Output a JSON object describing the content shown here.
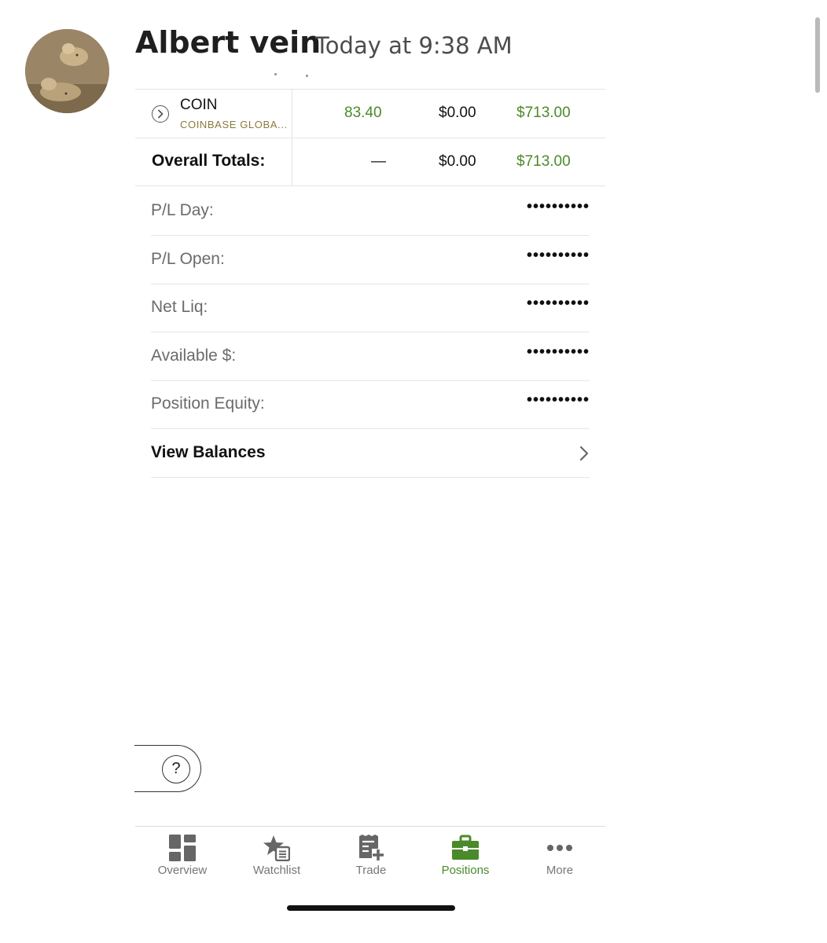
{
  "message": {
    "author": "Albert vein",
    "timestamp": "Today at 9:38 AM"
  },
  "position": {
    "symbol": "COIN",
    "company": "COINBASE GLOBA...",
    "price": "83.40",
    "pl_day": "$0.00",
    "pl_open": "$713.00"
  },
  "totals": {
    "label": "Overall Totals:",
    "price": "—",
    "pl_day": "$0.00",
    "pl_open": "$713.00"
  },
  "balances": [
    {
      "label": "P/L Day:",
      "value": "••••••••••"
    },
    {
      "label": "P/L Open:",
      "value": "••••••••••"
    },
    {
      "label": "Net Liq:",
      "value": "••••••••••"
    },
    {
      "label": "Available $:",
      "value": "••••••••••"
    },
    {
      "label": "Position Equity:",
      "value": "••••••••••"
    }
  ],
  "view_balances": "View Balances",
  "help": "?",
  "tabs": [
    {
      "label": "Overview",
      "icon": "overview-icon"
    },
    {
      "label": "Watchlist",
      "icon": "watchlist-star-icon"
    },
    {
      "label": "Trade",
      "icon": "trade-ticket-icon"
    },
    {
      "label": "Positions",
      "icon": "briefcase-icon",
      "active": true
    },
    {
      "label": "More",
      "icon": "more-dots-icon"
    }
  ],
  "colors": {
    "accent_green": "#4a8a2a",
    "company_gold": "#8a7a3c"
  }
}
